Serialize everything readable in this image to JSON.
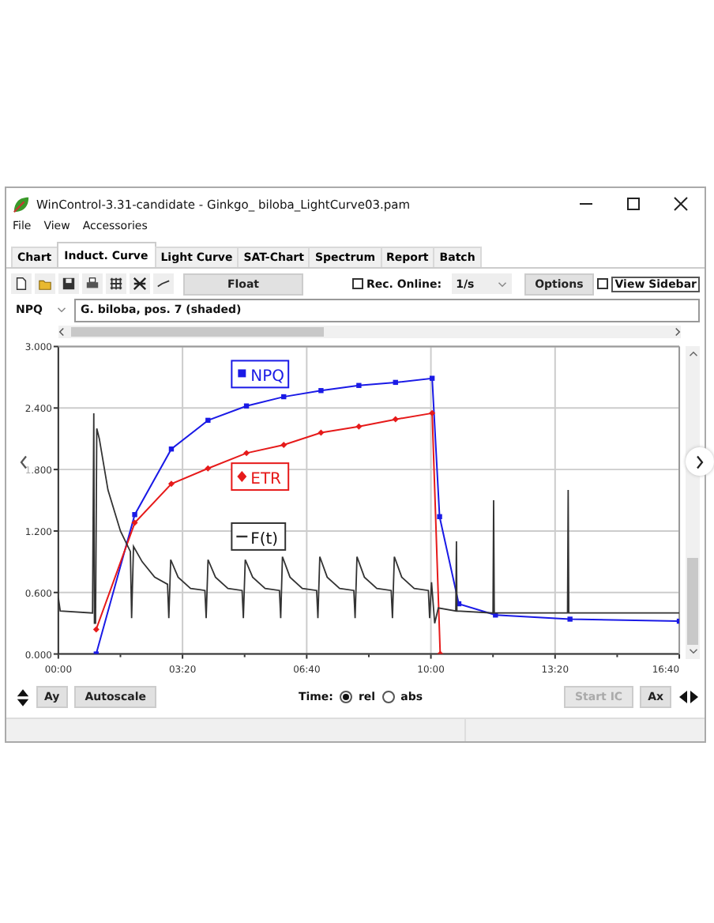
{
  "window": {
    "title": "WinControl-3.31-candidate - Ginkgo_ biloba_LightCurve03.pam"
  },
  "menu": [
    "File",
    "View",
    "Accessories"
  ],
  "tabs": [
    {
      "label": "Chart",
      "selected": false
    },
    {
      "label": "Induct. Curve",
      "selected": true
    },
    {
      "label": "Light Curve",
      "selected": false
    },
    {
      "label": "SAT-Chart",
      "selected": false
    },
    {
      "label": "Spectrum",
      "selected": false
    },
    {
      "label": "Report",
      "selected": false
    },
    {
      "label": "Batch",
      "selected": false
    }
  ],
  "toolbar": {
    "float_button": "Float",
    "rec_online": {
      "label": "Rec. Online:",
      "checked": false
    },
    "rate": {
      "value": "1/s"
    },
    "options_button": "Options",
    "view_sidebar": {
      "label": "View Sidebar",
      "checked": false
    }
  },
  "parameter_select": {
    "value": "NPQ"
  },
  "sample_name": {
    "value": "G. biloba, pos. 7 (shaded)"
  },
  "chart": {
    "chart_data": {
      "type": "line",
      "grid": true,
      "legend": true,
      "xlim": [
        0,
        1000
      ],
      "ylim": [
        0,
        3
      ],
      "xticks": [
        {
          "value": 0,
          "label": "00:00"
        },
        {
          "value": 200,
          "label": "03:20"
        },
        {
          "value": 400,
          "label": "06:40"
        },
        {
          "value": 600,
          "label": "10:00"
        },
        {
          "value": 800,
          "label": "13:20"
        },
        {
          "value": 1000,
          "label": "16:40"
        }
      ],
      "yticks": [
        {
          "value": 0,
          "label": "0.000"
        },
        {
          "value": 0.6,
          "label": "0.600"
        },
        {
          "value": 1.2,
          "label": "1.200"
        },
        {
          "value": 1.8,
          "label": "1.800"
        },
        {
          "value": 2.4,
          "label": "2.400"
        },
        {
          "value": 3,
          "label": "3.000"
        }
      ],
      "series": [
        {
          "name": "NPQ",
          "color": "#1a1ae6",
          "marker": "square",
          "x": [
            61,
            123,
            182,
            241,
            303,
            363,
            423,
            484,
            543,
            602,
            614,
            645,
            704,
            824,
            1000
          ],
          "values": [
            0,
            1.36,
            2.0,
            2.28,
            2.42,
            2.51,
            2.57,
            2.62,
            2.65,
            2.69,
            1.34,
            0.49,
            0.38,
            0.34,
            0.32
          ]
        },
        {
          "name": "ETR",
          "color": "#e61a1a",
          "marker": "diamond",
          "x": [
            61,
            123,
            182,
            241,
            303,
            363,
            423,
            484,
            543,
            602,
            615
          ],
          "values": [
            0.24,
            1.28,
            1.66,
            1.81,
            1.96,
            2.04,
            2.16,
            2.22,
            2.29,
            2.35,
            0
          ]
        },
        {
          "name": "F(t)",
          "color": "#333333",
          "marker": "none",
          "x": [
            0,
            3,
            55,
            57,
            58,
            60,
            62,
            66,
            80,
            100,
            116,
            118,
            121,
            135,
            155,
            176,
            178,
            181,
            193,
            213,
            236,
            238,
            241,
            253,
            273,
            296,
            298,
            301,
            313,
            333,
            356,
            358,
            361,
            373,
            393,
            416,
            418,
            421,
            433,
            453,
            476,
            478,
            481,
            493,
            513,
            536,
            538,
            541,
            553,
            573,
            596,
            598,
            601,
            606,
            612,
            640,
            641,
            642,
            700,
            701,
            702,
            820,
            821,
            822,
            1000
          ],
          "values": [
            0.55,
            0.42,
            0.4,
            2.35,
            0.3,
            0.3,
            2.2,
            2.1,
            1.6,
            1.2,
            1.0,
            0.35,
            1.05,
            0.9,
            0.75,
            0.68,
            0.35,
            0.92,
            0.75,
            0.64,
            0.62,
            0.35,
            0.92,
            0.75,
            0.64,
            0.62,
            0.35,
            0.92,
            0.75,
            0.64,
            0.62,
            0.35,
            0.95,
            0.75,
            0.64,
            0.62,
            0.35,
            0.95,
            0.75,
            0.64,
            0.62,
            0.35,
            0.95,
            0.75,
            0.64,
            0.62,
            0.35,
            0.95,
            0.75,
            0.64,
            0.62,
            0.35,
            0.7,
            0.3,
            0.45,
            0.42,
            1.1,
            0.42,
            0.4,
            1.5,
            0.4,
            0.4,
            1.6,
            0.4,
            0.4
          ]
        }
      ]
    }
  },
  "bottom": {
    "ay_button": "Ay",
    "autoscale_button": "Autoscale",
    "time": {
      "label": "Time:",
      "options": [
        {
          "label": "rel",
          "selected": true
        },
        {
          "label": "abs",
          "selected": false
        }
      ]
    },
    "start_ic_button": {
      "label": "Start IC",
      "disabled": true
    },
    "ax_button": "Ax"
  }
}
